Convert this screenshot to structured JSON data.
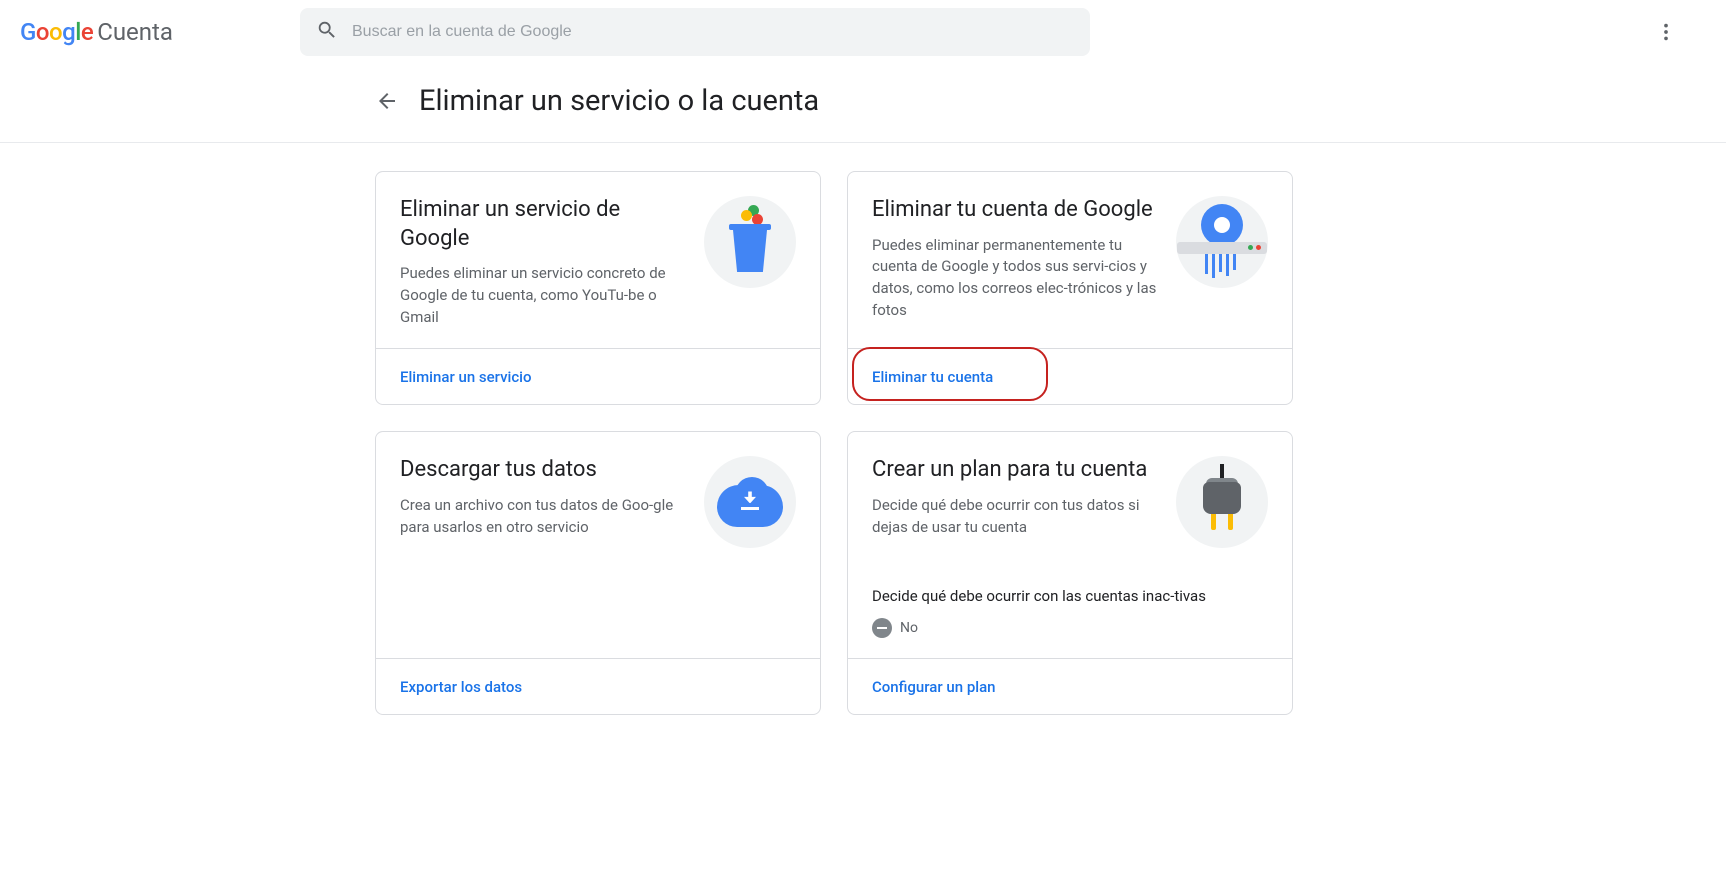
{
  "header": {
    "logo_g1": "G",
    "logo_o1": "o",
    "logo_o2": "o",
    "logo_g2": "g",
    "logo_l": "l",
    "logo_e": "e",
    "account_label": "Cuenta",
    "search_placeholder": "Buscar en la cuenta de Google"
  },
  "page": {
    "title": "Eliminar un servicio o la cuenta"
  },
  "cards": {
    "delete_service": {
      "title": "Eliminar un servicio de Google",
      "desc": "Puedes eliminar un servicio concreto de Google de tu cuenta, como YouTu‐be o Gmail",
      "action": "Eliminar un servicio"
    },
    "delete_account": {
      "title": "Eliminar tu cuenta de Google",
      "desc": "Puedes eliminar permanentemente tu cuenta de Google y todos sus servi‐cios y datos, como los correos elec‐trónicos y las fotos",
      "action": "Eliminar tu cuenta"
    },
    "download": {
      "title": "Descargar tus datos",
      "desc": "Crea un archivo con tus datos de Goo‐gle para usarlos en otro servicio",
      "action": "Exportar los datos"
    },
    "plan": {
      "title": "Crear un plan para tu cuenta",
      "desc": "Decide qué debe ocurrir con tus datos si dejas de usar tu cuenta",
      "extra_label": "Decide qué debe ocurrir con las cuentas inac‐tivas",
      "no_value": "No",
      "action": "Configurar un plan"
    }
  }
}
